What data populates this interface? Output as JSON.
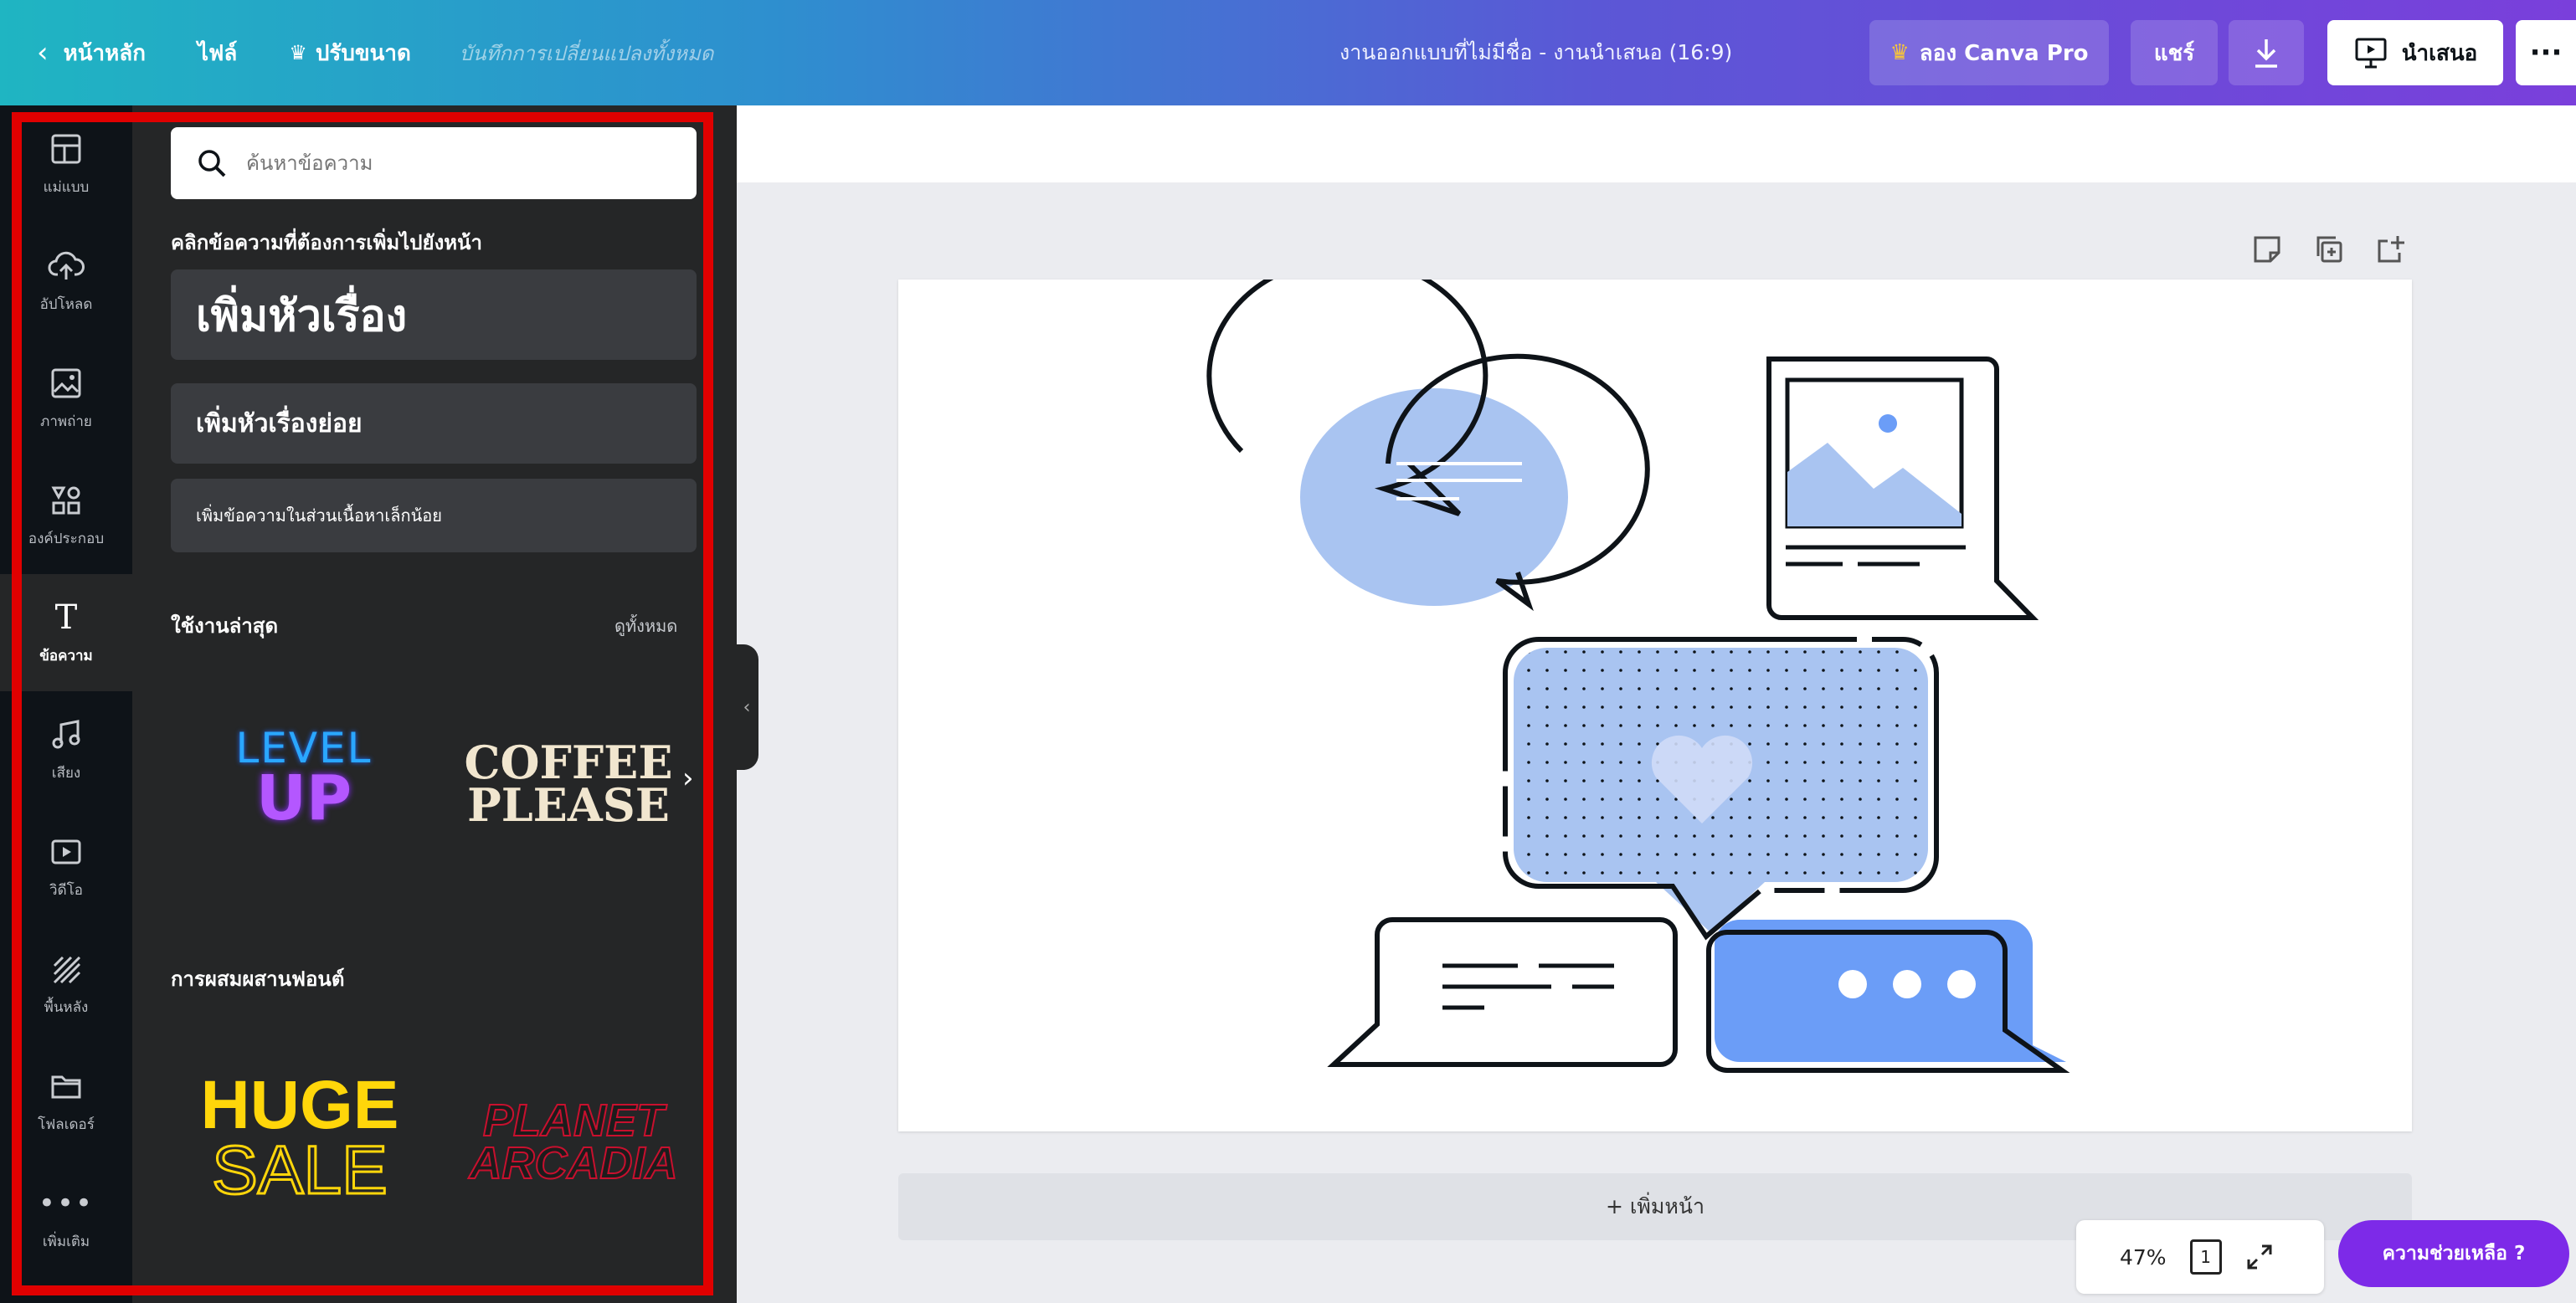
{
  "topbar": {
    "home": "หน้าหลัก",
    "file": "ไฟล์",
    "resize": "ปรับขนาด",
    "status": "บันทึกการเปลี่ยนแปลงทั้งหมด",
    "doc_title": "งานออกแบบที่ไม่มีชื่อ - งานนำเสนอ (16:9)",
    "try_pro": "ลอง Canva Pro",
    "share": "แชร์",
    "present": "นำเสนอ",
    "more": "···"
  },
  "rail": {
    "items": [
      {
        "label": "แม่แบบ",
        "icon": "template-icon"
      },
      {
        "label": "อัปโหลด",
        "icon": "upload-icon"
      },
      {
        "label": "ภาพถ่าย",
        "icon": "photo-icon"
      },
      {
        "label": "องค์ประกอบ",
        "icon": "elements-icon"
      },
      {
        "label": "ข้อความ",
        "icon": "text-icon"
      },
      {
        "label": "เสียง",
        "icon": "music-icon"
      },
      {
        "label": "วิดีโอ",
        "icon": "video-icon"
      },
      {
        "label": "พื้นหลัง",
        "icon": "background-icon"
      },
      {
        "label": "โฟลเดอร์",
        "icon": "folder-icon"
      },
      {
        "label": "เพิ่มเติม",
        "icon": "more-icon"
      }
    ],
    "active_index": 4
  },
  "panel": {
    "search_placeholder": "ค้นหาข้อความ",
    "click_hint": "คลิกข้อความที่ต้องการเพิ่มไปยังหน้า",
    "add_heading": "เพิ่มหัวเรื่อง",
    "add_subheading": "เพิ่มหัวเรื่องย่อย",
    "add_body": "เพิ่มข้อความในส่วนเนื้อหาเล็กน้อย",
    "recent_title": "ใช้งานล่าสุด",
    "see_all": "ดูทั้งหมด",
    "combos_title": "การผสมผสานฟอนต์",
    "tiles": {
      "level_line1": "LEVEL",
      "level_line2": "UP",
      "coffee_line1": "COFFEE",
      "coffee_line2": "PLEASE",
      "huge_line1": "HUGE",
      "huge_line2": "SALE",
      "planet_line1": "PLANET",
      "planet_line2": "ARCADIA"
    }
  },
  "workspace": {
    "add_page": "+ เพิ่มหน้า",
    "zoom": "47%",
    "page_count": "1",
    "help": "ความช่วยเหลือ ?"
  },
  "colors": {
    "accent_purple": "#7d2ae8",
    "panel_bg": "#252627",
    "rail_bg": "#0e1318",
    "highlight_frame": "#e00000",
    "bubble_light_blue": "#a9c4f1",
    "bubble_blue": "#6b9df7"
  }
}
